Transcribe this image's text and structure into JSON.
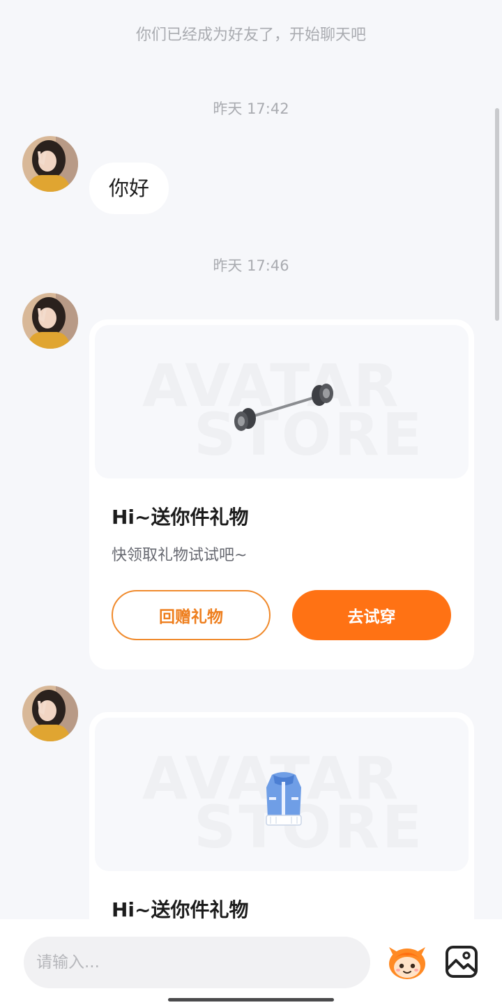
{
  "chat": {
    "system_notice": "你们已经成为好友了，开始聊天吧",
    "messages": [
      {
        "time": "昨天 17:42",
        "text": "你好"
      },
      {
        "time": "昨天 17:46",
        "gift_card": {
          "watermark_line1": "AVATAR",
          "watermark_line2": "STORE",
          "item_icon": "barbell-icon",
          "title": "Hi~送你件礼物",
          "subtitle": "快领取礼物试试吧~",
          "return_gift_label": "回赠礼物",
          "try_on_label": "去试穿"
        }
      },
      {
        "gift_card": {
          "watermark_line1": "AVATAR",
          "watermark_line2": "STORE",
          "item_icon": "jacket-icon",
          "title": "Hi~送你件礼物"
        }
      }
    ]
  },
  "input_bar": {
    "placeholder": "请输入...",
    "emoji_icon": "mascot-emoji-icon",
    "image_icon": "image-icon"
  },
  "colors": {
    "accent": "#ff7214",
    "accent_outline": "#f08a2c",
    "background": "#f6f7fa",
    "muted_text": "#a9abb0"
  }
}
